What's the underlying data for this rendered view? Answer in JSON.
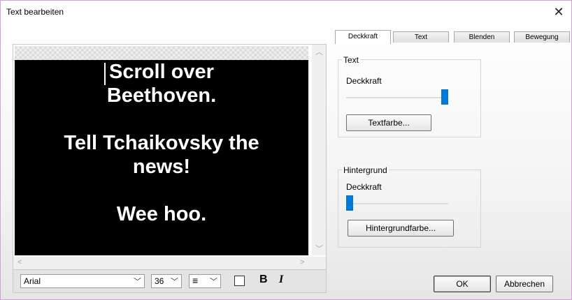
{
  "window": {
    "title": "Text bearbeiten",
    "close_glyph": "✕"
  },
  "preview": {
    "lines": [
      "Scroll over",
      "Beethoven.",
      "",
      "Tell Tchaikovsky the",
      "news!",
      "",
      "Wee hoo."
    ]
  },
  "toolbar": {
    "font": "Arial",
    "size": "36",
    "align_glyph": "≡",
    "bold_label": "B",
    "italic_label": "I"
  },
  "tabs": [
    {
      "label": "Deckkraft",
      "active": true
    },
    {
      "label": "Text",
      "active": false
    },
    {
      "label": "Blenden",
      "active": false
    },
    {
      "label": "Bewegung",
      "active": false
    }
  ],
  "text_group": {
    "title": "Text",
    "opacity_label": "Deckkraft",
    "opacity_value": 1.0,
    "color_button": "Textfarbe..."
  },
  "background_group": {
    "title": "Hintergrund",
    "opacity_label": "Deckkraft",
    "opacity_value": 0.0,
    "color_button": "Hintergrundfarbe..."
  },
  "footer": {
    "ok": "OK",
    "cancel": "Abbrechen"
  },
  "colors": {
    "accent": "#0078d7",
    "canvas_bg": "#000000",
    "canvas_text": "#ffffff"
  }
}
